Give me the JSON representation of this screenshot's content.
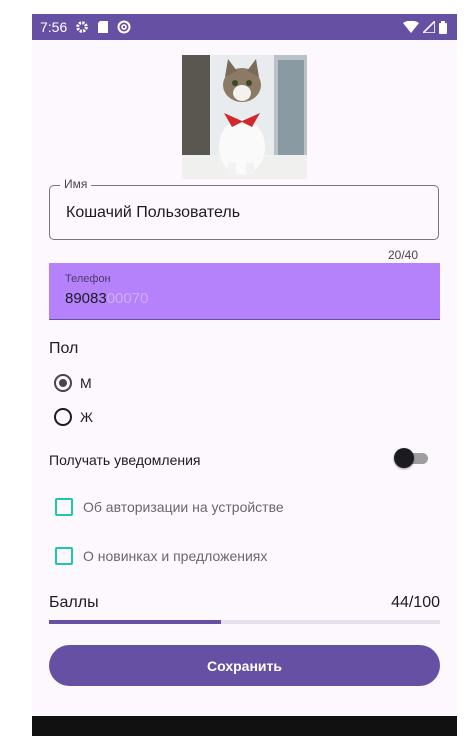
{
  "status_bar": {
    "time": "7:56",
    "left_icons": [
      "gear-icon",
      "sim-card-icon",
      "at-sign-icon"
    ],
    "right_icons": [
      "wifi-icon",
      "signal-icon",
      "battery-icon"
    ]
  },
  "profile": {
    "avatar": "cat-photo",
    "name_label": "Имя",
    "name_value": "Кошачий Пользователь",
    "name_counter": "20/40",
    "phone_label": "Телефон",
    "phone_value": "89083",
    "phone_placeholder_tail": "00070"
  },
  "gender": {
    "title": "Пол",
    "options": [
      {
        "label": "М",
        "selected": true
      },
      {
        "label": "Ж",
        "selected": false
      }
    ]
  },
  "notifications": {
    "label": "Получать уведомления",
    "enabled": false,
    "options": [
      {
        "label": "Об авторизации на устройстве",
        "checked": false
      },
      {
        "label": "О новинках и предложениях",
        "checked": false
      }
    ]
  },
  "points": {
    "label": "Баллы",
    "value_text": "44/100",
    "fraction": 0.44
  },
  "save_button_label": "Сохранить",
  "colors": {
    "primary": "#6650a4",
    "phone_field_bg": "#b582fb",
    "checkbox": "#1cc7b1",
    "background": "#fdf8fd"
  }
}
